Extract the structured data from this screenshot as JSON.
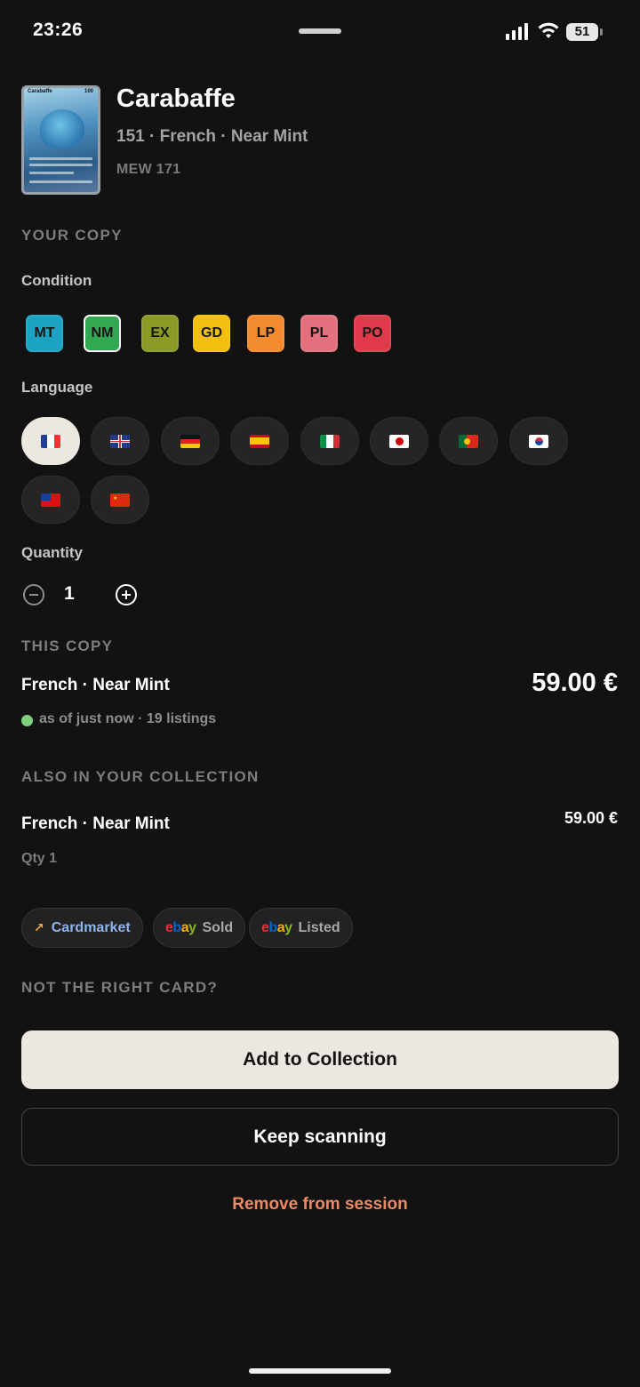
{
  "status_bar": {
    "time": "23:26",
    "battery": "51"
  },
  "card": {
    "name": "Carabaffe",
    "subtitle": "151 · French · Near Mint",
    "code": "MEW 171",
    "thumb_name": "Carabaffe",
    "thumb_hp": "100"
  },
  "your_copy": {
    "section": "YOUR COPY",
    "condition_label": "Condition",
    "conditions": [
      {
        "code": "MT",
        "color": "#1aa3c2"
      },
      {
        "code": "NM",
        "color": "#33a852"
      },
      {
        "code": "EX",
        "color": "#8a9a24"
      },
      {
        "code": "GD",
        "color": "#f2bf0f"
      },
      {
        "code": "LP",
        "color": "#f38a2e"
      },
      {
        "code": "PL",
        "color": "#e4707e"
      },
      {
        "code": "PO",
        "color": "#e03a4a"
      }
    ],
    "selected_condition": "NM",
    "language_label": "Language",
    "languages": [
      "fr",
      "gb",
      "de",
      "es",
      "it",
      "jp",
      "pt",
      "kr",
      "tw",
      "cn"
    ],
    "selected_language": "fr",
    "quantity_label": "Quantity",
    "quantity": "1"
  },
  "this_copy": {
    "section": "THIS COPY",
    "variant": "French · Near Mint",
    "price": "59.00 €",
    "meta": "as of just now · 19 listings"
  },
  "also_in_collection": {
    "section": "ALSO IN YOUR COLLECTION",
    "variant": "French · Near Mint",
    "price": "59.00 €",
    "qty": "Qty 1"
  },
  "links": {
    "cardmarket": "Cardmarket",
    "ebay_sold": "Sold",
    "ebay_listed": "Listed",
    "ebay_e": "e",
    "ebay_b": "b",
    "ebay_a": "a",
    "ebay_y": "y"
  },
  "not_right": "NOT THE RIGHT CARD?",
  "actions": {
    "add": "Add to Collection",
    "keep": "Keep scanning",
    "remove": "Remove from session"
  },
  "colors": {
    "accent_remove": "#ee8a63",
    "live_dot": "#7fcf7c"
  }
}
